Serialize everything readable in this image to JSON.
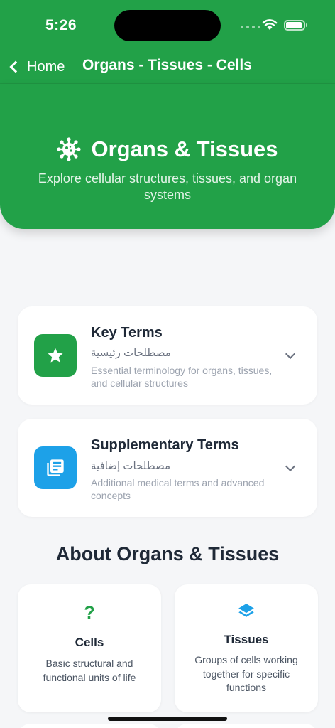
{
  "status_bar": {
    "time": "5:26"
  },
  "nav": {
    "back_label": "Home",
    "title": "Organs - Tissues - Cells"
  },
  "hero": {
    "icon": "virus-cell-icon",
    "title": "Organs & Tissues",
    "subtitle": "Explore cellular structures, tissues, and organ systems"
  },
  "sections": [
    {
      "title": "Key Terms",
      "arabic": "مصطلحات رئيسية",
      "description": "Essential terminology for organs, tissues, and cellular structures",
      "icon": "star-icon",
      "color": "#22a148"
    },
    {
      "title": "Supplementary Terms",
      "arabic": "مصطلحات إضافية",
      "description": "Additional medical terms and advanced concepts",
      "icon": "library-books-icon",
      "color": "#1da1e8"
    }
  ],
  "about": {
    "title": "About Organs & Tissues",
    "cards": [
      {
        "name": "Cells",
        "description": "Basic structural and functional units of life",
        "icon": "question-mark-icon",
        "color": "#22a148"
      },
      {
        "name": "Tissues",
        "description": "Groups of cells working together for specific functions",
        "icon": "layers-icon",
        "color": "#1da1e8"
      }
    ]
  }
}
